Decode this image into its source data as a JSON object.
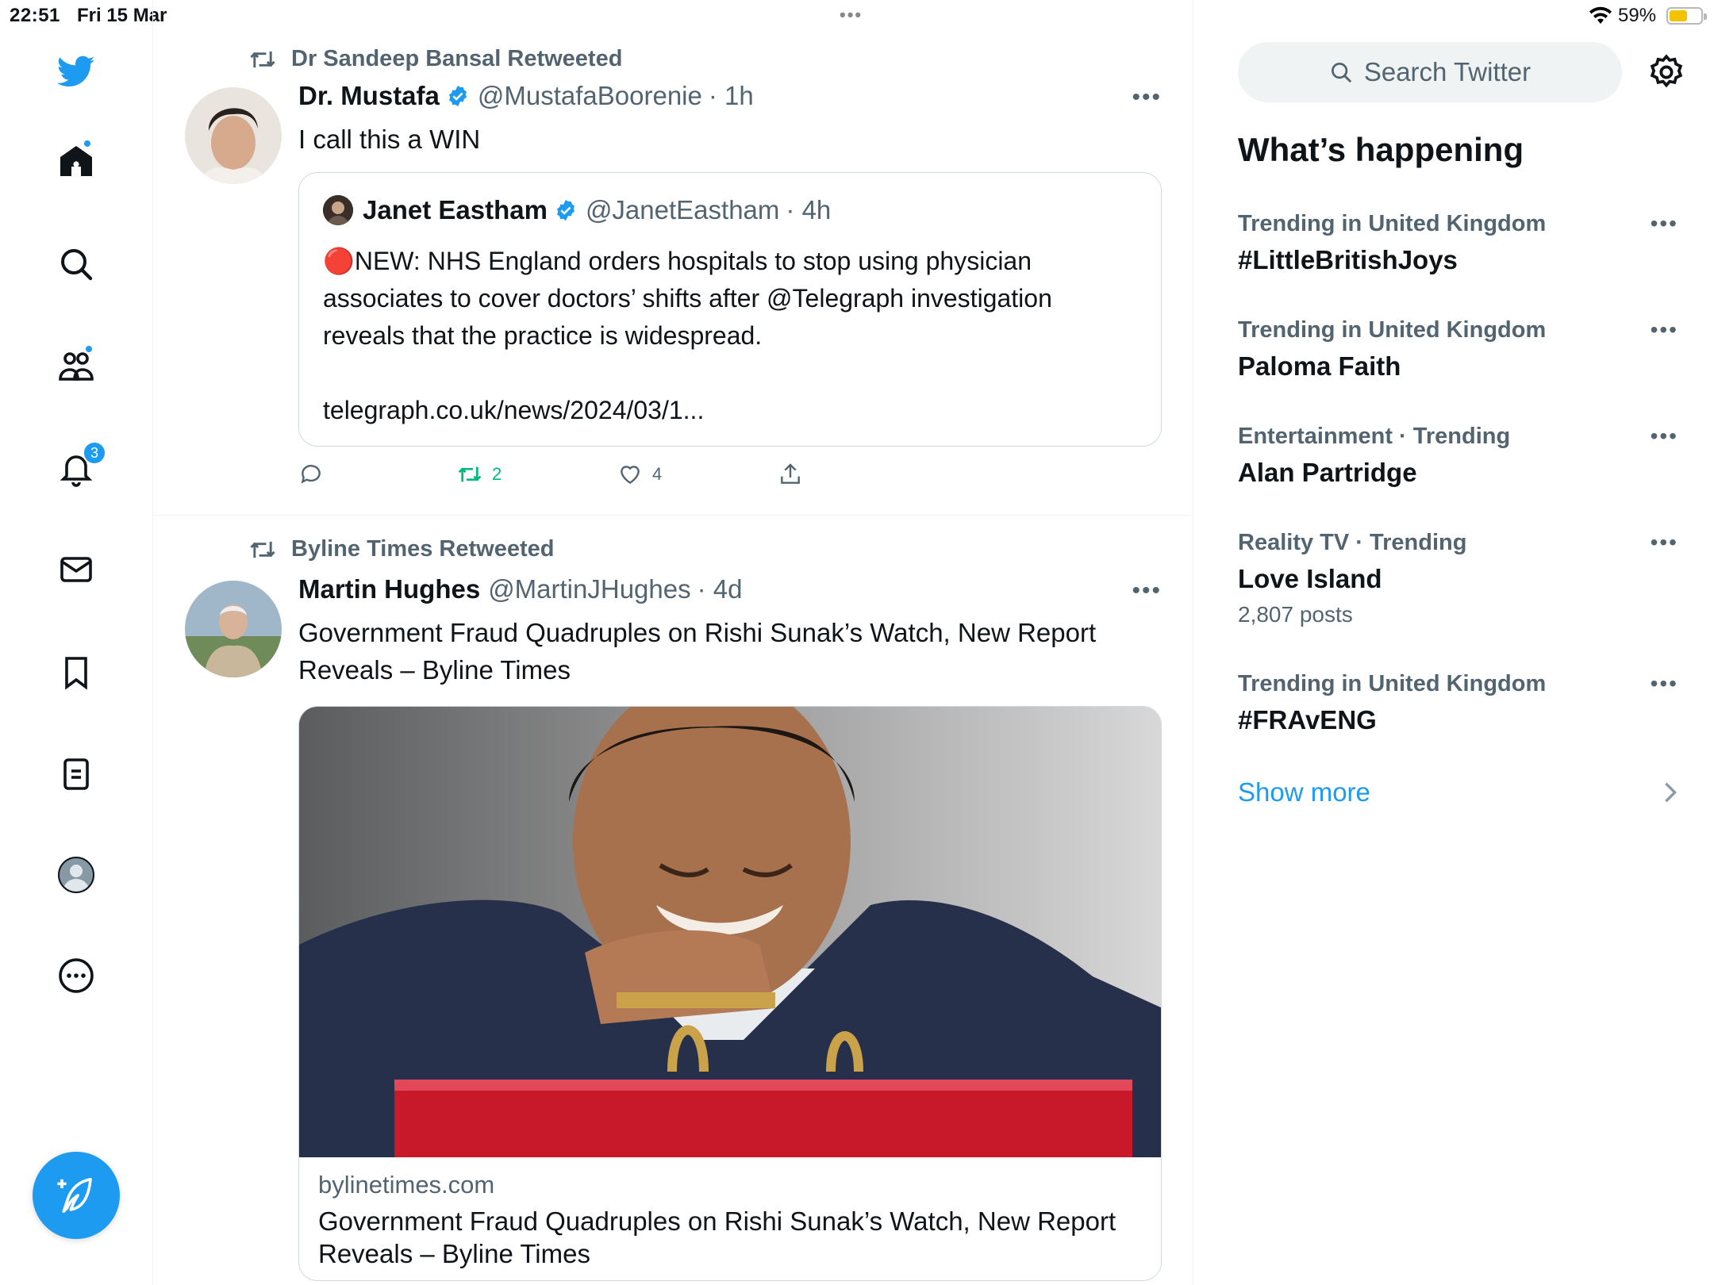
{
  "status_bar": {
    "time": "22:51",
    "date": "Fri 15 Mar",
    "battery": "59%",
    "battery_level": 0.59
  },
  "colors": {
    "accent": "#1d9bf0",
    "retweet_active": "#00ba7c",
    "muted": "#536471"
  },
  "nav": {
    "icons": [
      "twitter-logo-icon",
      "home-icon",
      "search-icon",
      "communities-icon",
      "bell-icon",
      "mail-icon",
      "bookmark-icon",
      "lists-icon",
      "profile-icon",
      "more-icon"
    ],
    "notification_count": "3"
  },
  "timeline": {
    "tweets": [
      {
        "retweeted_by": "Dr Sandeep Bansal Retweeted",
        "name": "Dr. Mustafa",
        "handle": "@MustafaBoorenie",
        "time": "· 1h",
        "text": "I call this a WIN",
        "quote": {
          "name": "Janet Eastham",
          "handle": "@JanetEastham",
          "time": "· 4h",
          "line1": "🔴NEW: NHS England orders hospitals to stop using physician",
          "line2": "associates to cover doctors’ shifts after @Telegraph investigation",
          "line3": "reveals that the practice is widespread.",
          "link": "telegraph.co.uk/news/2024/03/1..."
        },
        "actions": {
          "retweets": "2",
          "likes": "4"
        }
      },
      {
        "retweeted_by": "Byline Times Retweeted",
        "name": "Martin Hughes",
        "handle": "@MartinJHughes",
        "time": "· 4d",
        "text_line1": "Government Fraud Quadruples on Rishi Sunak’s Watch, New Report",
        "text_line2": "Reveals – Byline Times",
        "card": {
          "domain": "bylinetimes.com",
          "title_line1": "Government Fraud Quadruples on Rishi Sunak’s Watch, New Report",
          "title_line2": "Reveals – Byline Times"
        }
      }
    ]
  },
  "sidebar": {
    "search_placeholder": "Search Twitter",
    "section_title": "What’s happening",
    "trends": [
      {
        "context": "Trending in United Kingdom",
        "topic": "#LittleBritishJoys"
      },
      {
        "context": "Trending in United Kingdom",
        "topic": "Paloma Faith"
      },
      {
        "context": "Entertainment · Trending",
        "topic": "Alan Partridge"
      },
      {
        "context": "Reality TV · Trending",
        "topic": "Love Island",
        "count": "2,807 posts"
      },
      {
        "context": "Trending in United Kingdom",
        "topic": "#FRAvENG"
      }
    ],
    "show_more": "Show more"
  }
}
